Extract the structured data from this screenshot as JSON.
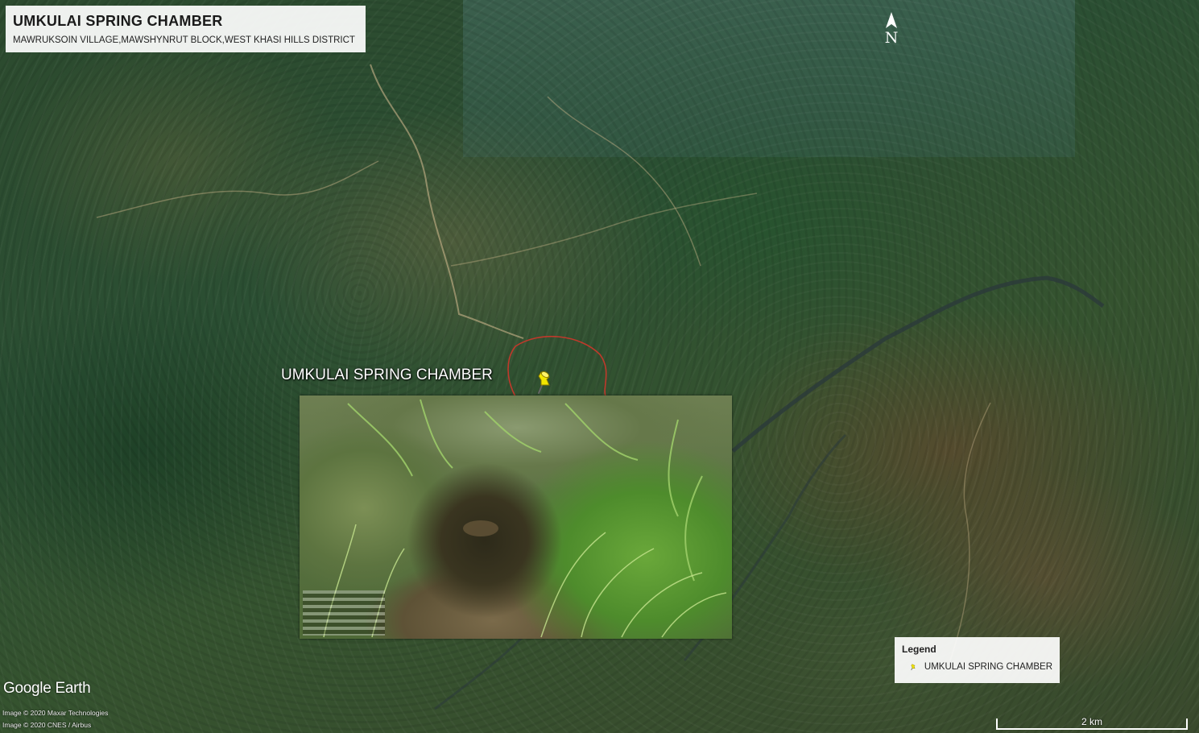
{
  "header": {
    "title": "UMKULAI SPRING CHAMBER",
    "subtitle": "MAWRUKSOIN VILLAGE,MAWSHYNRUT BLOCK,WEST KHASI HILLS DISTRICT"
  },
  "north_arrow": {
    "label": "N"
  },
  "placemark": {
    "label": "UMKULAI SPRING CHAMBER",
    "icon": "yellow-pushpin-icon",
    "icon_color": "#f2e600"
  },
  "legend": {
    "title": "Legend",
    "items": [
      {
        "label": "UMKULAI SPRING CHAMBER",
        "icon": "yellow-pushpin-icon",
        "color": "#f2e600"
      }
    ]
  },
  "attribution": {
    "logo": "Google Earth",
    "credits": [
      "Image © 2020 Maxar Technologies",
      "Image © 2020 CNES / Airbus"
    ]
  },
  "scale": {
    "label": "2 km"
  },
  "colors": {
    "boundary": "#c0392b",
    "river": "#2b3b3a",
    "road": "#c9b48a"
  }
}
